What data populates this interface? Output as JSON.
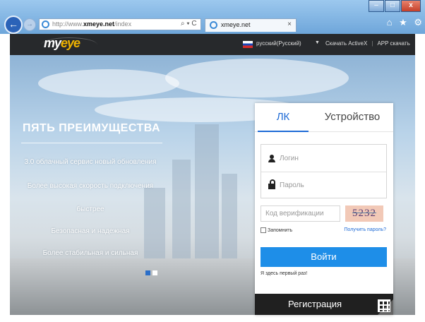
{
  "browser": {
    "url_prefix": "http://www.",
    "url_domain": "xmeye.net",
    "url_suffix": "/index",
    "search_icons": "⌕ ▾ C",
    "tab_title": "xmeye.net",
    "tab_close": "×",
    "back_glyph": "←",
    "forward_glyph": "→",
    "min_glyph": "–",
    "max_glyph": "□",
    "close_glyph": "x",
    "home_glyph": "⌂",
    "star_glyph": "★",
    "gear_glyph": "⚙"
  },
  "header": {
    "logo_text_a": "my",
    "logo_text_b": "eye",
    "language": "русский(Русский)",
    "language_arrow": "▼",
    "download_activex": "Скачать ActiveX",
    "separator": "|",
    "download_app": "APP скачать"
  },
  "hero": {
    "title": "ПЯТЬ ПРЕИМУЩЕСТВА",
    "features": [
      "3.0 облачный сервис новый обновления",
      "Более высокая скорость подключения",
      "быстрее",
      "Безопасная и надежная",
      "Более стабильная и сильная"
    ]
  },
  "login": {
    "tab_lk": "ЛК",
    "tab_device": "Устройство",
    "login_placeholder": "Логин",
    "password_placeholder": "Пароль",
    "captcha_placeholder": "Код верификации",
    "captcha_code": "5232",
    "remember": "Запомнить",
    "forgot": "Получить пароль?",
    "submit": "Войти",
    "first_time": "Я здесь первый раз!",
    "register": "Регистрация"
  },
  "colors": {
    "accent": "#1e8ee8",
    "header_bg": "#27292c",
    "register_bg": "#202020"
  }
}
